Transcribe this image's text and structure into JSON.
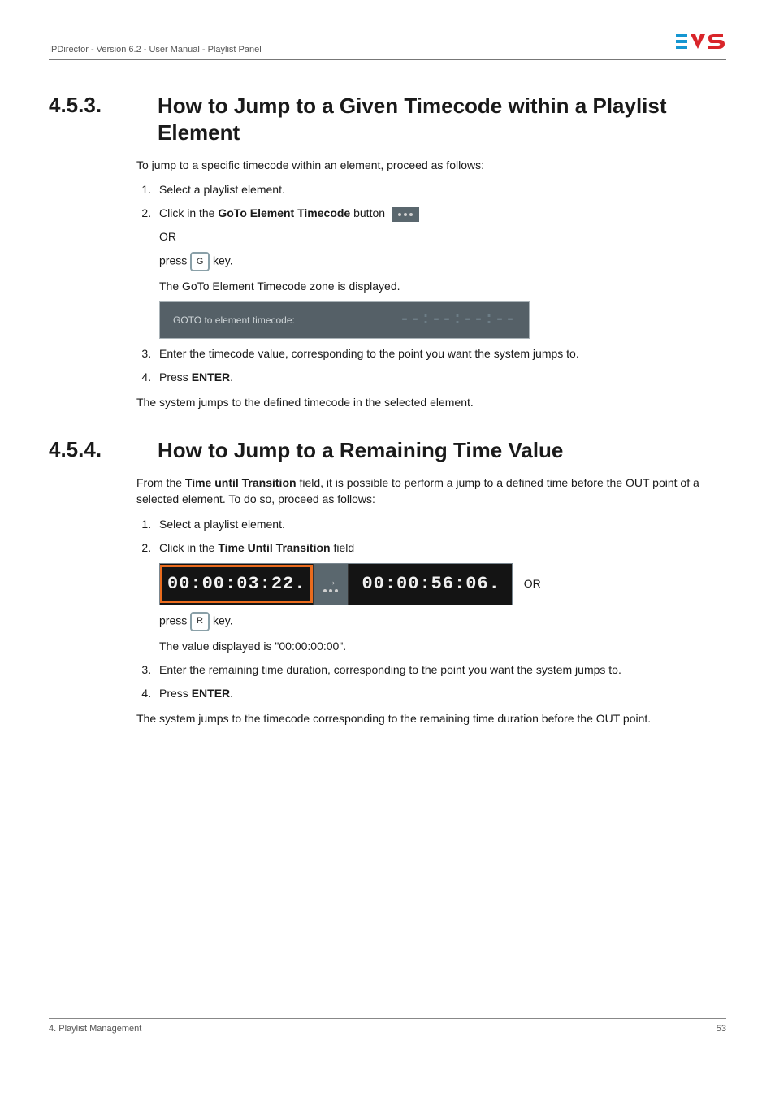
{
  "header": {
    "title": "IPDirector - Version 6.2 - User Manual - Playlist Panel"
  },
  "section453": {
    "num": "4.5.3.",
    "title": "How to Jump to a Given Timecode within a Playlist Element",
    "intro": "To jump to a specific timecode within an element, proceed as follows:",
    "steps": {
      "s1": "Select a playlist element.",
      "s2a": "Click in the ",
      "s2b": "GoTo Element Timecode",
      "s2c": " button ",
      "or": "OR",
      "press_a": "press ",
      "press_key": "G",
      "press_b": " key.",
      "s2_result": "The GoTo Element Timecode zone is displayed.",
      "goto_label": "GOTO to element timecode:",
      "goto_tc": "--:--:--:--",
      "s3": "Enter the timecode value, corresponding to the point you want the system jumps to.",
      "s4a": "Press ",
      "s4b": "ENTER",
      "s4c": "."
    },
    "outro": "The system jumps to the defined timecode in the selected element."
  },
  "section454": {
    "num": "4.5.4.",
    "title": "How to Jump to a Remaining Time Value",
    "intro_a": "From the ",
    "intro_b": "Time until Transition",
    "intro_c": " field, it is possible to perform a jump to a defined time before the OUT point of a selected element. To do so, proceed as follows:",
    "steps": {
      "s1": "Select a playlist element.",
      "s2a": "Click in the ",
      "s2b": "Time Until Transition",
      "s2c": " field",
      "tc_left": "00:00:03:22.",
      "tc_right": "00:00:56:06.",
      "or": "OR",
      "press_a": "press ",
      "press_key": "R",
      "press_b": " key.",
      "s2_result": "The value displayed is \"00:00:00:00\".",
      "s3": "Enter the remaining time duration, corresponding to the point you want the system jumps to.",
      "s4a": "Press ",
      "s4b": "ENTER",
      "s4c": "."
    },
    "outro": "The system jumps to the timecode corresponding to the remaining time duration before the OUT point."
  },
  "footer": {
    "left": "4. Playlist Management",
    "right": "53"
  }
}
